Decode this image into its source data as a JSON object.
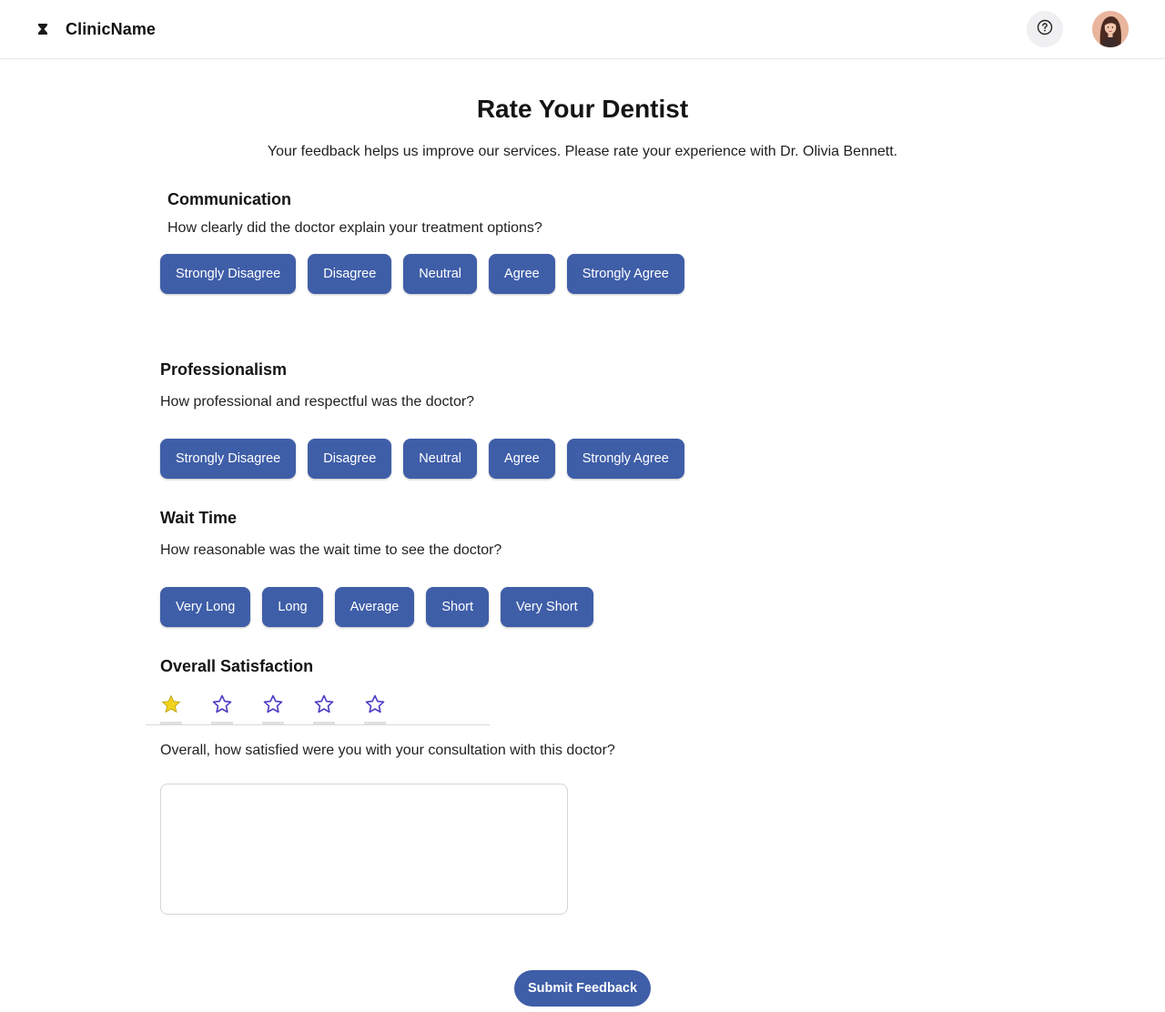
{
  "header": {
    "brand_name": "ClinicName",
    "logo_icon": "hourglass-logo-icon",
    "help_icon": "question-circle-icon",
    "avatar_alt": "User avatar"
  },
  "page": {
    "title": "Rate Your Dentist",
    "subtitle": "Your feedback helps us improve our services. Please rate your experience with Dr. Olivia Bennett."
  },
  "sections": {
    "communication": {
      "title": "Communication",
      "question": "How clearly did the doctor explain your treatment options?",
      "options": [
        "Strongly Disagree",
        "Disagree",
        "Neutral",
        "Agree",
        "Strongly Agree"
      ]
    },
    "professionalism": {
      "title": "Professionalism",
      "question": "How professional and respectful was the doctor?",
      "options": [
        "Strongly Disagree",
        "Disagree",
        "Neutral",
        "Agree",
        "Strongly Agree"
      ]
    },
    "wait_time": {
      "title": "Wait Time",
      "question": "How reasonable was the wait time to see the doctor?",
      "options": [
        "Very Long",
        "Long",
        "Average",
        "Short",
        "Very Short"
      ]
    },
    "overall": {
      "title": "Overall Satisfaction",
      "rating": 1,
      "max_rating": 5,
      "question": "Overall, how satisfied were you with your consultation with this doctor?",
      "comment_value": ""
    }
  },
  "submit_label": "Submit Feedback",
  "colors": {
    "button_bg": "#3f5ea8",
    "button_text": "#ffffff",
    "star_filled": "#f2d31b",
    "star_outline": "#4a3bc4",
    "divider": "#e6e6e6"
  }
}
